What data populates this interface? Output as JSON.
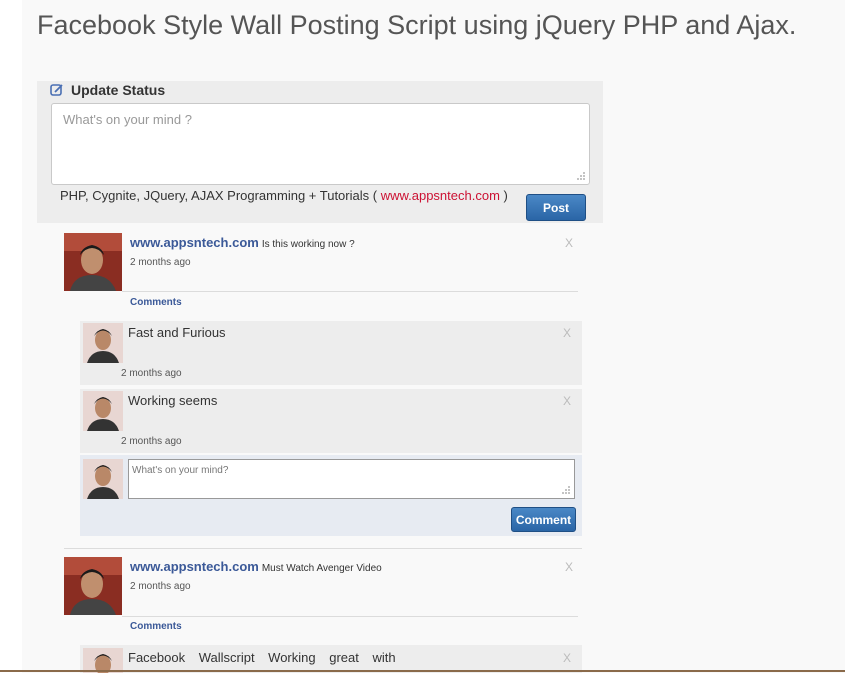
{
  "page": {
    "title": "Facebook Style Wall Posting Script using jQuery PHP and Ajax."
  },
  "update_status": {
    "header": "Update Status",
    "placeholder": "What's on your mind ?",
    "tagline_prefix": "PHP, Cygnite, JQuery, AJAX Programming + Tutorials (",
    "tagline_link": "www.appsntech.com",
    "tagline_suffix": ")",
    "post_label": "Post"
  },
  "posts": [
    {
      "author": "www.appsntech.com",
      "message": "Is this working now ?",
      "time": "2 months ago",
      "close": "X",
      "comments_label": "Comments",
      "comments": [
        {
          "text": "Fast and Furious",
          "time": "2 months ago",
          "close": "X"
        },
        {
          "text": "Working seems",
          "time": "2 months ago",
          "close": "X"
        }
      ],
      "reply_placeholder": "What's on your mind?",
      "reply_button": "Comment"
    },
    {
      "author": "www.appsntech.com",
      "message": "Must Watch Avenger Video",
      "time": "2 months ago",
      "close": "X",
      "comments_label": "Comments",
      "comments": [
        {
          "text": "Facebook Wallscript Working great with",
          "close": "X"
        }
      ]
    }
  ],
  "colors": {
    "link_blue": "#3b5998",
    "button_blue": "#2a65a6",
    "tagline_link_red": "#cc1133",
    "panel_gray": "#ededed"
  }
}
